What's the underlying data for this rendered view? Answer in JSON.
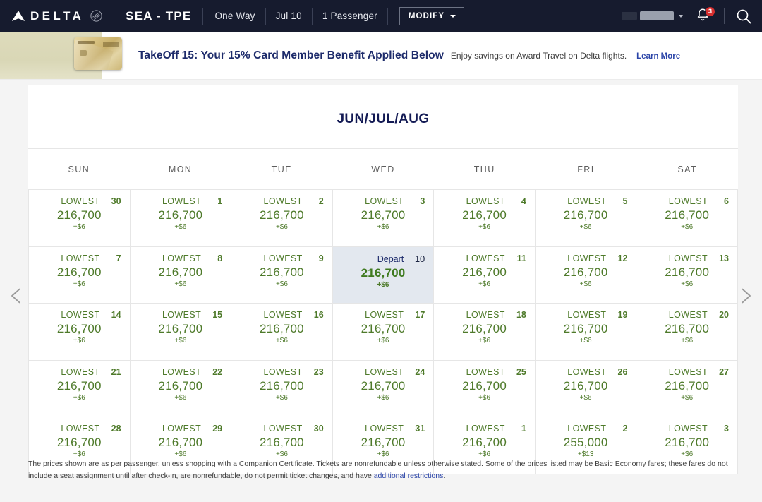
{
  "header": {
    "brand": "DELTA",
    "route": "SEA - TPE",
    "trip_type": "One Way",
    "date": "Jul 10",
    "passengers": "1 Passenger",
    "modify_label": "MODIFY",
    "notification_count": "3"
  },
  "banner": {
    "title": "TakeOff 15: Your 15% Card Member Benefit Applied Below",
    "subtitle": "Enjoy savings on Award Travel on Delta flights.",
    "link": "Learn More"
  },
  "calendar": {
    "title": "JUN/JUL/AUG",
    "weekdays": [
      "SUN",
      "MON",
      "TUE",
      "WED",
      "THU",
      "FRI",
      "SAT"
    ],
    "lowest_label": "LOWEST",
    "depart_label": "Depart",
    "weeks": [
      [
        {
          "day": "30",
          "label": "LOWEST",
          "price": "216,700",
          "tax": "+$6",
          "selected": false
        },
        {
          "day": "1",
          "label": "LOWEST",
          "price": "216,700",
          "tax": "+$6",
          "selected": false
        },
        {
          "day": "2",
          "label": "LOWEST",
          "price": "216,700",
          "tax": "+$6",
          "selected": false
        },
        {
          "day": "3",
          "label": "LOWEST",
          "price": "216,700",
          "tax": "+$6",
          "selected": false
        },
        {
          "day": "4",
          "label": "LOWEST",
          "price": "216,700",
          "tax": "+$6",
          "selected": false
        },
        {
          "day": "5",
          "label": "LOWEST",
          "price": "216,700",
          "tax": "+$6",
          "selected": false
        },
        {
          "day": "6",
          "label": "LOWEST",
          "price": "216,700",
          "tax": "+$6",
          "selected": false
        }
      ],
      [
        {
          "day": "7",
          "label": "LOWEST",
          "price": "216,700",
          "tax": "+$6",
          "selected": false
        },
        {
          "day": "8",
          "label": "LOWEST",
          "price": "216,700",
          "tax": "+$6",
          "selected": false
        },
        {
          "day": "9",
          "label": "LOWEST",
          "price": "216,700",
          "tax": "+$6",
          "selected": false
        },
        {
          "day": "10",
          "label": "Depart",
          "price": "216,700",
          "tax": "+$6",
          "selected": true
        },
        {
          "day": "11",
          "label": "LOWEST",
          "price": "216,700",
          "tax": "+$6",
          "selected": false
        },
        {
          "day": "12",
          "label": "LOWEST",
          "price": "216,700",
          "tax": "+$6",
          "selected": false
        },
        {
          "day": "13",
          "label": "LOWEST",
          "price": "216,700",
          "tax": "+$6",
          "selected": false
        }
      ],
      [
        {
          "day": "14",
          "label": "LOWEST",
          "price": "216,700",
          "tax": "+$6",
          "selected": false
        },
        {
          "day": "15",
          "label": "LOWEST",
          "price": "216,700",
          "tax": "+$6",
          "selected": false
        },
        {
          "day": "16",
          "label": "LOWEST",
          "price": "216,700",
          "tax": "+$6",
          "selected": false
        },
        {
          "day": "17",
          "label": "LOWEST",
          "price": "216,700",
          "tax": "+$6",
          "selected": false
        },
        {
          "day": "18",
          "label": "LOWEST",
          "price": "216,700",
          "tax": "+$6",
          "selected": false
        },
        {
          "day": "19",
          "label": "LOWEST",
          "price": "216,700",
          "tax": "+$6",
          "selected": false
        },
        {
          "day": "20",
          "label": "LOWEST",
          "price": "216,700",
          "tax": "+$6",
          "selected": false
        }
      ],
      [
        {
          "day": "21",
          "label": "LOWEST",
          "price": "216,700",
          "tax": "+$6",
          "selected": false
        },
        {
          "day": "22",
          "label": "LOWEST",
          "price": "216,700",
          "tax": "+$6",
          "selected": false
        },
        {
          "day": "23",
          "label": "LOWEST",
          "price": "216,700",
          "tax": "+$6",
          "selected": false
        },
        {
          "day": "24",
          "label": "LOWEST",
          "price": "216,700",
          "tax": "+$6",
          "selected": false
        },
        {
          "day": "25",
          "label": "LOWEST",
          "price": "216,700",
          "tax": "+$6",
          "selected": false
        },
        {
          "day": "26",
          "label": "LOWEST",
          "price": "216,700",
          "tax": "+$6",
          "selected": false
        },
        {
          "day": "27",
          "label": "LOWEST",
          "price": "216,700",
          "tax": "+$6",
          "selected": false
        }
      ],
      [
        {
          "day": "28",
          "label": "LOWEST",
          "price": "216,700",
          "tax": "+$6",
          "selected": false
        },
        {
          "day": "29",
          "label": "LOWEST",
          "price": "216,700",
          "tax": "+$6",
          "selected": false
        },
        {
          "day": "30",
          "label": "LOWEST",
          "price": "216,700",
          "tax": "+$6",
          "selected": false
        },
        {
          "day": "31",
          "label": "LOWEST",
          "price": "216,700",
          "tax": "+$6",
          "selected": false
        },
        {
          "day": "1",
          "label": "LOWEST",
          "price": "216,700",
          "tax": "+$6",
          "selected": false
        },
        {
          "day": "2",
          "label": "LOWEST",
          "price": "255,000",
          "tax": "+$13",
          "selected": false
        },
        {
          "day": "3",
          "label": "LOWEST",
          "price": "216,700",
          "tax": "+$6",
          "selected": false
        }
      ]
    ]
  },
  "footer": {
    "text_before_link": "The prices shown are as per passenger, unless shopping with a Companion Certificate. Tickets are nonrefundable unless otherwise stated. Some of the prices listed may be Basic Economy fares; these fares do not include a seat assignment until after check-in, are nonrefundable, do not permit ticket changes, and have ",
    "link": "additional restrictions",
    "text_after_link": "."
  },
  "colors": {
    "header_bg": "#161b2e",
    "brand_navy": "#1d2b6b",
    "award_green": "#4e7a2a",
    "selected_bg": "#e3e8ef",
    "badge_red": "#d62f2f"
  }
}
